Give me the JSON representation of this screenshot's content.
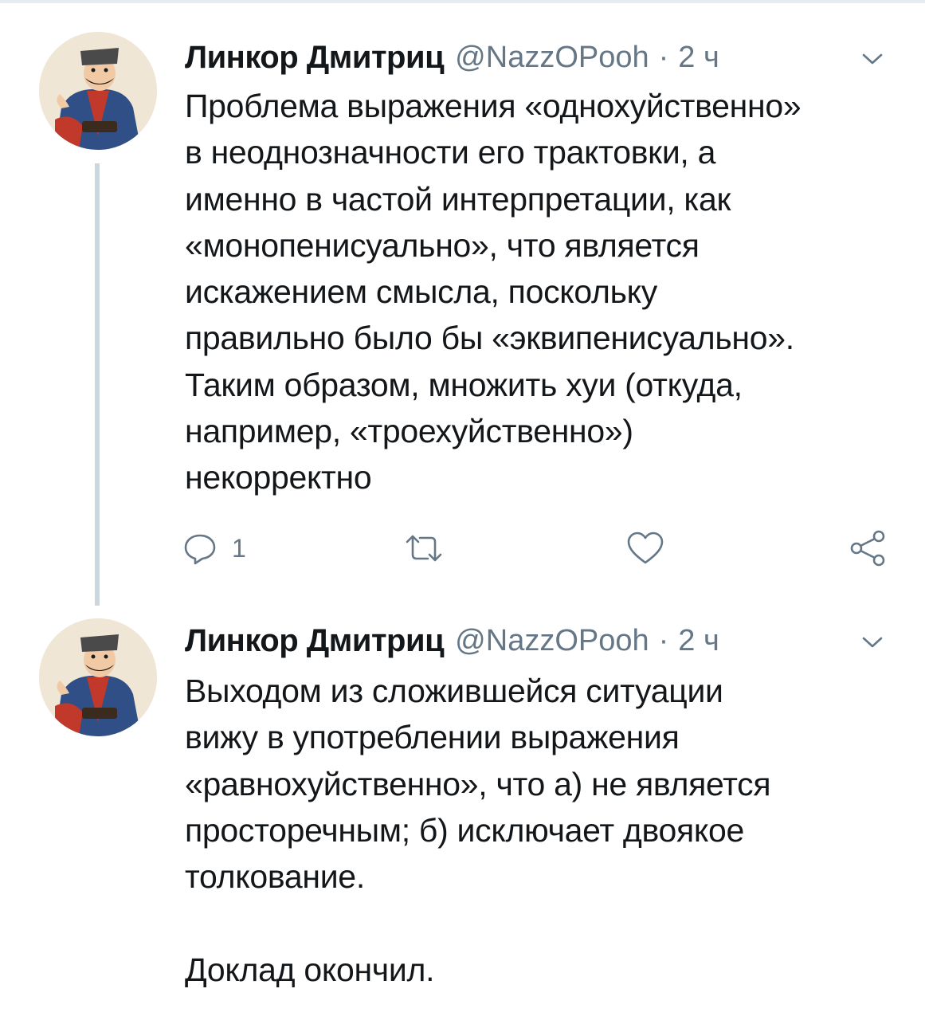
{
  "tweets": [
    {
      "author_name": "Линкор Дмитриц",
      "handle": "@NazzOPooh",
      "separator": "·",
      "time": "2 ч",
      "avatar_icon": "cossack-avatar",
      "lines": [
        "Проблема выражения «однохуйственно»",
        "в неоднозначности его трактовки, а",
        "именно в частой интерпретации, как",
        "«монопенисуально», что является",
        "искажением смысла, поскольку",
        "правильно было бы «эквипенисуально».",
        "Таким образом, множить хуи (откуда,",
        "например, «троехуйственно»)",
        "некорректно"
      ],
      "actions": {
        "reply_count": "1",
        "reply_icon": "reply-icon",
        "retweet_icon": "retweet-icon",
        "like_icon": "heart-icon",
        "share_icon": "share-icon"
      }
    },
    {
      "author_name": "Линкор Дмитриц",
      "handle": "@NazzOPooh",
      "separator": "·",
      "time": "2 ч",
      "avatar_icon": "cossack-avatar",
      "lines": [
        "Выходом из сложившейся ситуации",
        "вижу в употреблении выражения",
        "«равнохуйственно», что а) не является",
        "просторечным; б) исключает двоякое",
        "толкование.",
        "",
        "Доклад окончил."
      ]
    }
  ],
  "colors": {
    "text": "#14171a",
    "secondary": "#657786",
    "thread_line": "#ccd6dd",
    "background": "#ffffff"
  }
}
